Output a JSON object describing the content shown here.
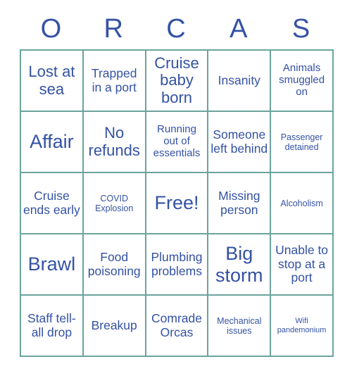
{
  "card": {
    "title_letters": [
      "O",
      "R",
      "C",
      "A",
      "S"
    ],
    "accent_color": "#3452a4",
    "grid_line_color": "#6ba49d",
    "background_color": "#ffffff",
    "rows": [
      [
        {
          "text": "Lost at sea",
          "size": "lg"
        },
        {
          "text": "Trapped in a port",
          "size": "md"
        },
        {
          "text": "Cruise baby born",
          "size": "lg"
        },
        {
          "text": "Insanity",
          "size": "md"
        },
        {
          "text": "Animals smuggled on",
          "size": "sm"
        }
      ],
      [
        {
          "text": "Affair",
          "size": "xl"
        },
        {
          "text": "No refunds",
          "size": "lg"
        },
        {
          "text": "Running out of essentials",
          "size": "sm"
        },
        {
          "text": "Someone left behind",
          "size": "md"
        },
        {
          "text": "Passenger detained",
          "size": "xs"
        }
      ],
      [
        {
          "text": "Cruise ends early",
          "size": "md"
        },
        {
          "text": "COVID Explosion",
          "size": "xs"
        },
        {
          "text": "Free!",
          "size": "xl"
        },
        {
          "text": "Missing person",
          "size": "md"
        },
        {
          "text": "Alcoholism",
          "size": "xs"
        }
      ],
      [
        {
          "text": "Brawl",
          "size": "xl"
        },
        {
          "text": "Food poisoning",
          "size": "md"
        },
        {
          "text": "Plumbing problems",
          "size": "md"
        },
        {
          "text": "Big storm",
          "size": "xl"
        },
        {
          "text": "Unable to stop at a port",
          "size": "md"
        }
      ],
      [
        {
          "text": "Staff tell-all drop",
          "size": "md"
        },
        {
          "text": "Breakup",
          "size": "md"
        },
        {
          "text": "Comrade Orcas",
          "size": "md"
        },
        {
          "text": "Mechanical issues",
          "size": "xs"
        },
        {
          "text": "Wifi pandemonium",
          "size": "xxs"
        }
      ]
    ]
  }
}
